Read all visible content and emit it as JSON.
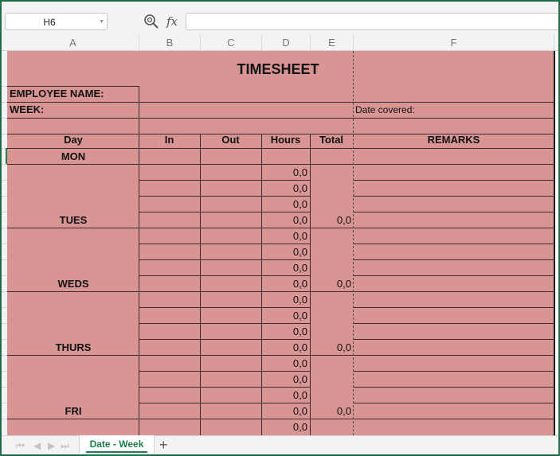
{
  "formula_bar": {
    "name_box": "H6",
    "fx_label": "fx",
    "formula_value": ""
  },
  "columns": [
    "A",
    "B",
    "C",
    "D",
    "E",
    "F"
  ],
  "sheet": {
    "title": "TIMESHEET",
    "employee_label": "EMPLOYEE NAME:",
    "week_label": "WEEK:",
    "date_covered_label": "Date covered:",
    "headers": {
      "day": "Day",
      "in": "In",
      "out": "Out",
      "hours": "Hours",
      "total": "Total",
      "remarks": "REMARKS"
    },
    "days": [
      "MON",
      "TUES",
      "WEDS",
      "THURS",
      "FRI"
    ],
    "hours_values": [
      "0,0",
      "0,0",
      "0,0",
      "0,0",
      "0,0",
      "0,0",
      "0,0",
      "0,0",
      "0,0",
      "0,0",
      "0,0",
      "0,0",
      "0,0",
      "0,0",
      "0,0",
      "0,0",
      "0,0"
    ],
    "totals": [
      "0,0",
      "0,0",
      "0,0",
      "0,0"
    ]
  },
  "tabs": {
    "sheet_name": "Date - Week",
    "add_label": "+",
    "nav": [
      "⏮",
      "◀",
      "▶",
      "⏭"
    ]
  },
  "colors": {
    "fill": "#d99594",
    "accent": "#1f7a4c"
  }
}
